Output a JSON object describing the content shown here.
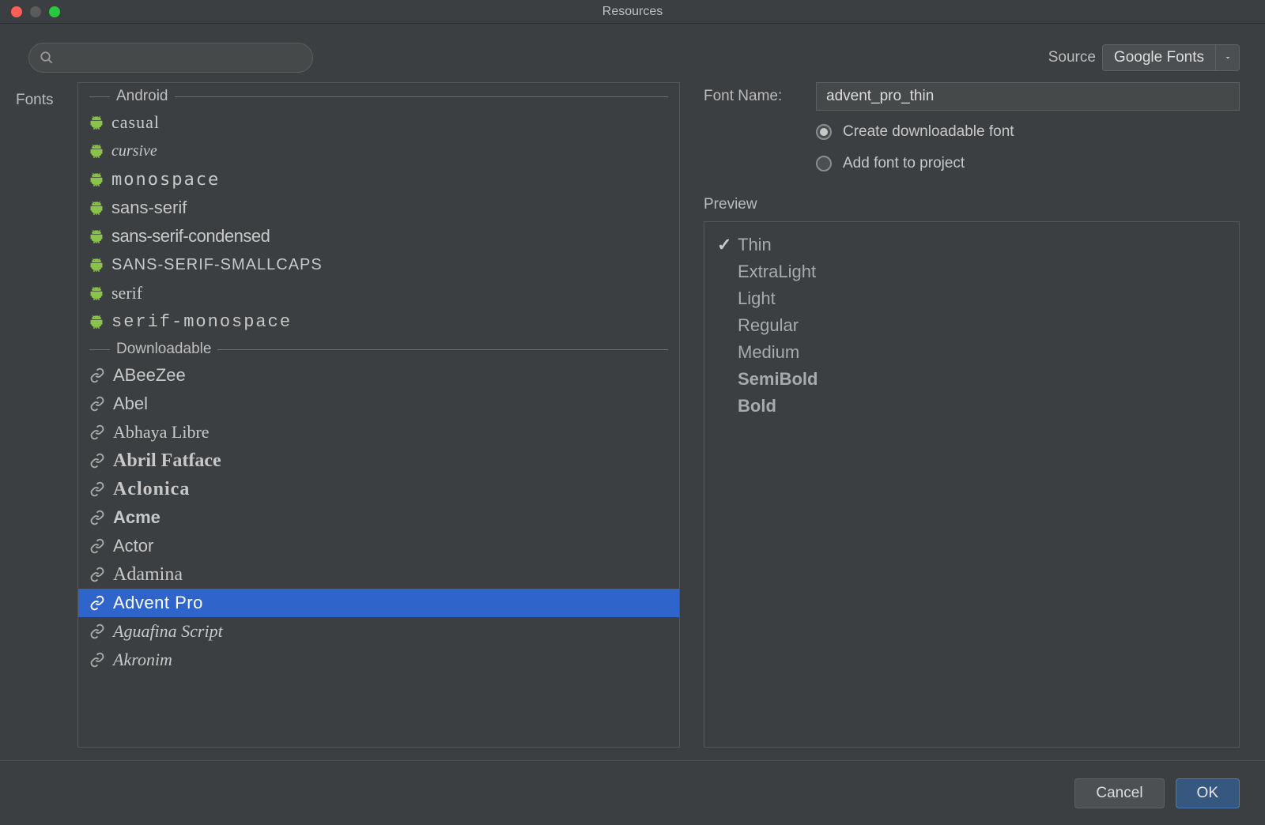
{
  "window": {
    "title": "Resources"
  },
  "search": {
    "placeholder": ""
  },
  "source": {
    "label": "Source",
    "selected": "Google Fonts"
  },
  "left": {
    "label": "Fonts",
    "groups": {
      "android": {
        "title": "Android",
        "items": [
          {
            "name": "casual",
            "style": "f-casual"
          },
          {
            "name": "cursive",
            "style": "f-cursive"
          },
          {
            "name": "monospace",
            "style": "f-monospace"
          },
          {
            "name": "sans-serif",
            "style": "f-sans-serif"
          },
          {
            "name": "sans-serif-condensed",
            "style": "f-sans-serif-condensed"
          },
          {
            "name": "SANS-SERIF-SMALLCAPS",
            "style": "f-smallcaps"
          },
          {
            "name": "serif",
            "style": "f-serif"
          },
          {
            "name": "serif-monospace",
            "style": "f-serif-monospace"
          }
        ]
      },
      "downloadable": {
        "title": "Downloadable",
        "items": [
          {
            "name": "ABeeZee",
            "style": "f-abeezee"
          },
          {
            "name": "Abel",
            "style": "f-abel"
          },
          {
            "name": "Abhaya Libre",
            "style": "f-abhaya"
          },
          {
            "name": "Abril Fatface",
            "style": "f-abril"
          },
          {
            "name": "Aclonica",
            "style": "f-aclonica"
          },
          {
            "name": "Acme",
            "style": "f-acme"
          },
          {
            "name": "Actor",
            "style": "f-actor"
          },
          {
            "name": "Adamina",
            "style": "f-adamina"
          },
          {
            "name": "Advent Pro",
            "style": "f-advent",
            "selected": true
          },
          {
            "name": "Aguafina Script",
            "style": "f-aguafina"
          },
          {
            "name": "Akronim",
            "style": "f-akronim"
          }
        ]
      }
    }
  },
  "form": {
    "fontNameLabel": "Font Name:",
    "fontNameValue": "advent_pro_thin",
    "radio1": "Create downloadable font",
    "radio2": "Add font to project",
    "radioSelected": 0
  },
  "preview": {
    "label": "Preview",
    "items": [
      {
        "label": "Thin",
        "weight": "pw-100",
        "checked": true
      },
      {
        "label": "ExtraLight",
        "weight": "pw-200",
        "checked": false
      },
      {
        "label": "Light",
        "weight": "pw-300",
        "checked": false
      },
      {
        "label": "Regular",
        "weight": "pw-400",
        "checked": false
      },
      {
        "label": "Medium",
        "weight": "pw-500",
        "checked": false
      },
      {
        "label": "SemiBold",
        "weight": "pw-600",
        "checked": false
      },
      {
        "label": "Bold",
        "weight": "pw-700",
        "checked": false
      }
    ]
  },
  "footer": {
    "cancel": "Cancel",
    "ok": "OK"
  }
}
